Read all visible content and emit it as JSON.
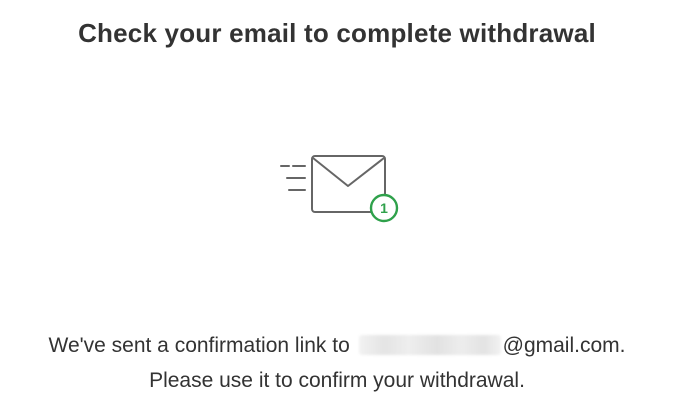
{
  "dialog": {
    "title": "Check your email to complete withdrawal",
    "message_line1_prefix": "We've sent a confirmation link to",
    "email_domain": "@gmail.com.",
    "message_line2": "Please use it to confirm your withdrawal."
  },
  "illustration": {
    "icon": "envelope-sent-icon",
    "badge_count": "1",
    "envelope_color": "#666666",
    "badge_color": "#2fa14b"
  }
}
